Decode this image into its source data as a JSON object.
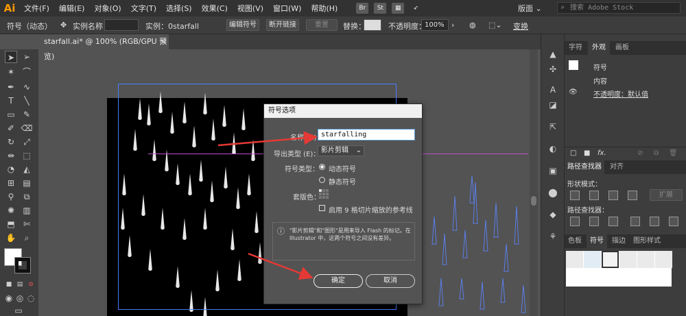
{
  "app": {
    "logo": "Ai"
  },
  "menu": [
    "文件(F)",
    "编辑(E)",
    "对象(O)",
    "文字(T)",
    "选择(S)",
    "效果(C)",
    "视图(V)",
    "窗口(W)",
    "帮助(H)"
  ],
  "menu_pills": [
    "Br",
    "St"
  ],
  "workspace": "版面",
  "stock_search": {
    "placeholder": "搜索 Adobe Stock"
  },
  "control_bar": {
    "selection_label": "符号（动态）",
    "instance_name_label": "实例名称：",
    "instance_name_value": "",
    "instance_label": "实例：0starfall",
    "edit_symbol": "编辑符号",
    "break_link": "断开链接",
    "reset": "重置",
    "replace_label": "替换：",
    "opacity_label": "不透明度：",
    "opacity_value": "100%",
    "transform": "变换"
  },
  "document_tab": "starfall.ai* @ 100% (RGB/GPU 预览)",
  "dialog": {
    "title": "符号选项",
    "name_label": "名称 (N)：",
    "name_value": "starfalling",
    "export_type_label": "导出类型 (E)：",
    "export_type_value": "影片剪辑",
    "symbol_type_label": "符号类型：",
    "dynamic_symbol": "动态符号",
    "static_symbol": "静态符号",
    "registration_label": "套版色：",
    "nine_slice_label": "启用 9 格切片缩放的参考线",
    "info_text": "\"影片剪辑\"和\"图形\"是用来导入 Flash 的标记。在 Illustrator 中，这两个符号之间没有差异。",
    "ok": "确定",
    "cancel": "取消"
  },
  "panels": {
    "top_tabs": [
      "字符",
      "外观",
      "画板"
    ],
    "appearance": {
      "item": "符号",
      "content": "内容",
      "opacity": "不透明度：默认值"
    },
    "pathfinder_tabs": [
      "路径查找器",
      "对齐"
    ],
    "shape_modes": "形状模式：",
    "pathfinders": "路径查找器：",
    "expand": "扩展",
    "bottom_tabs": [
      "色板",
      "符号",
      "描边",
      "图形样式"
    ]
  },
  "colors": {
    "menubar": "#323232",
    "panel": "#3d3d3d",
    "canvas": "#535353",
    "accent_arrow": "#e53935",
    "selection": "#4a7cff"
  }
}
